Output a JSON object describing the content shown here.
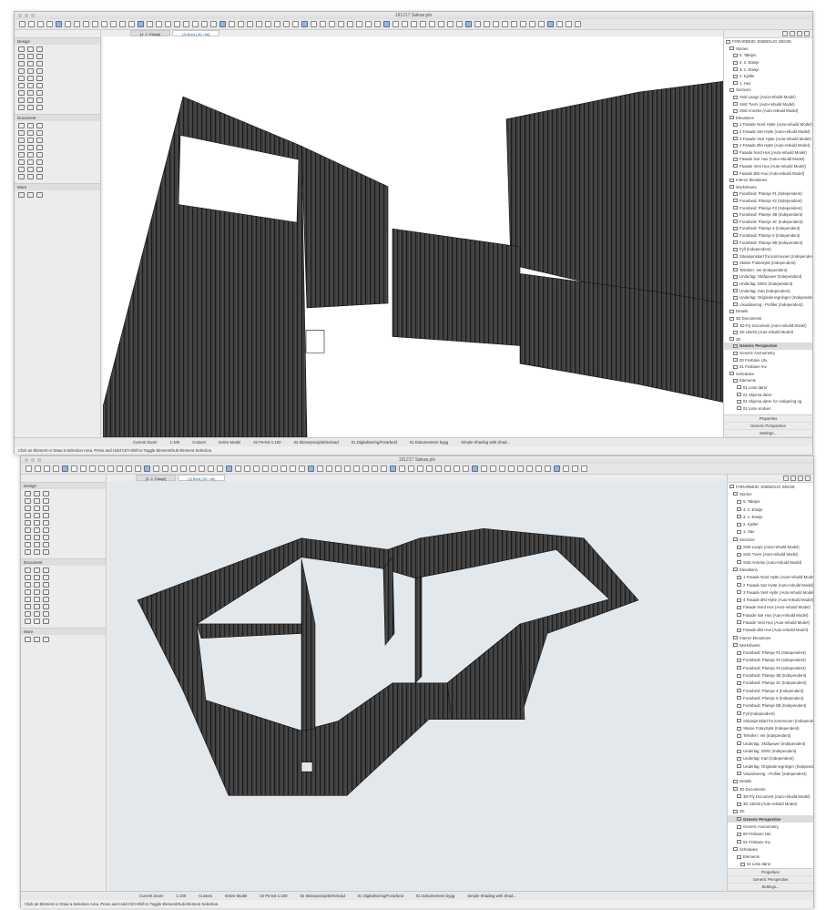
{
  "window_title": "191217 Søksø.pln",
  "tabs": [
    "[4. 2. Etasje]",
    "[3] Bred [3D / All]"
  ],
  "toolbox": {
    "groups": [
      "Design",
      "Document",
      "More"
    ]
  },
  "navigator": {
    "items": [
      {
        "label": "FORARBEID: ENEBOLIG SEKSE",
        "level": 0
      },
      {
        "label": "Stories",
        "level": 1
      },
      {
        "label": "5. Taksjer",
        "level": 2
      },
      {
        "label": "4. 2. Etasje",
        "level": 2
      },
      {
        "label": "3. 1. Etasje",
        "level": 2
      },
      {
        "label": "2. Kjeller",
        "level": 2
      },
      {
        "label": "1. Hav",
        "level": 2
      },
      {
        "label": "Sections",
        "level": 1
      },
      {
        "label": "Snitt Langs (Auto-rebuild Model)",
        "level": 2
      },
      {
        "label": "Snitt Tvers (Auto-rebuild Model)",
        "level": 2
      },
      {
        "label": "Snitt Annebs (Auto-rebuild Model)",
        "level": 2
      },
      {
        "label": "Elevations",
        "level": 1
      },
      {
        "label": "1 Fasade Nord Hytte (Auto-rebuild Model)",
        "level": 2
      },
      {
        "label": "2 Fasade Sør Hytte (Auto-rebuild Model)",
        "level": 2
      },
      {
        "label": "3 Fasade Vest Hytte (Auto-rebuild Model)",
        "level": 2
      },
      {
        "label": "4 Fasade Øst Hytte (Auto-rebuild Model)",
        "level": 2
      },
      {
        "label": "Fasade Nord Hus (Auto-rebuild Model)",
        "level": 2
      },
      {
        "label": "Fasade Sør Hus (Auto-rebuild Model)",
        "level": 2
      },
      {
        "label": "Fasade Vest Hus (Auto-rebuild Model)",
        "level": 2
      },
      {
        "label": "Fasade Øst Hus (Auto-rebuild Model)",
        "level": 2
      },
      {
        "label": "Interior Elevations",
        "level": 1
      },
      {
        "label": "Worksheets",
        "level": 1
      },
      {
        "label": "Forarbeid: Plansje #1 (Independent)",
        "level": 2
      },
      {
        "label": "Forarbeid: Plansje #2 (Independent)",
        "level": 2
      },
      {
        "label": "Forarbeid: Plansje #3 (Independent)",
        "level": 2
      },
      {
        "label": "Forarbeid: Plansje 3B (Independent)",
        "level": 2
      },
      {
        "label": "Forarbeid: Plansje 3C (Independent)",
        "level": 2
      },
      {
        "label": "Forarbeid: Plansje 4 (Independent)",
        "level": 2
      },
      {
        "label": "Forarbeid: Plansje 5 (Independent)",
        "level": 2
      },
      {
        "label": "Forarbeid: Plansje 5B (Independent)",
        "level": 2
      },
      {
        "label": "Fyll (Independent)",
        "level": 2
      },
      {
        "label": "Situasjonskart fra kommunen (Independent)",
        "level": 2
      },
      {
        "label": "Skisse Fotavtrykk (Independent)",
        "level": 2
      },
      {
        "label": "Tekniker: Vei (Independent)",
        "level": 2
      },
      {
        "label": "Underlag: Skråpower (Independent)",
        "level": 2
      },
      {
        "label": "Underlag: DWG (Independent)",
        "level": 2
      },
      {
        "label": "Underlag: Kart (Independent)",
        "level": 2
      },
      {
        "label": "Underlag: Originale tegninger (Independent)",
        "level": 2
      },
      {
        "label": "Visualisering - Profiler (Independent)",
        "level": 2
      },
      {
        "label": "Details",
        "level": 1
      },
      {
        "label": "3D Documents",
        "level": 1
      },
      {
        "label": "3D-Fly Document (Auto-rebuild Model)",
        "level": 2
      },
      {
        "label": "3D Utsnitt (Auto-rebuild Model)",
        "level": 2
      },
      {
        "label": "3D",
        "level": 1
      },
      {
        "label": "Generic Perspective",
        "level": 2,
        "selected": true
      },
      {
        "label": "Generic Axonometry",
        "level": 2
      },
      {
        "label": "00 Fimbane Utv.",
        "level": 2
      },
      {
        "label": "01 Fimbane Inv.",
        "level": 2
      },
      {
        "label": "Schedules",
        "level": 1
      },
      {
        "label": "Elements",
        "level": 2
      },
      {
        "label": "01 Liste dører",
        "level": 3
      },
      {
        "label": "01 Skjema dører",
        "level": 3
      },
      {
        "label": "01 Skjema dører for redigering og",
        "level": 3
      },
      {
        "label": "01 Liste vinduer",
        "level": 3
      }
    ]
  },
  "properties": {
    "title": "Properties",
    "value": "Generic Perspective",
    "button": "Settings..."
  },
  "status": {
    "controls": [
      "Current Zoom",
      "1:100",
      "Custom",
      "Entire Model",
      "02 Permit 1:100",
      "02 Skisseprosjekt/Sekvad",
      "01 Digitalisering/Forarbeid",
      "01 Dokumentere bygg",
      "Simple Shading with Shad..."
    ],
    "message": "Click an Element or Draw a Selection Area. Press and Hold Ctrl+Shift to Toggle Element/Sub-Element Selection."
  },
  "colors": {
    "model": "#3b3b3b",
    "viewport_top": "#ffffff",
    "viewport_bottom": "#e3e8ec",
    "accent": "#2a5db0"
  }
}
